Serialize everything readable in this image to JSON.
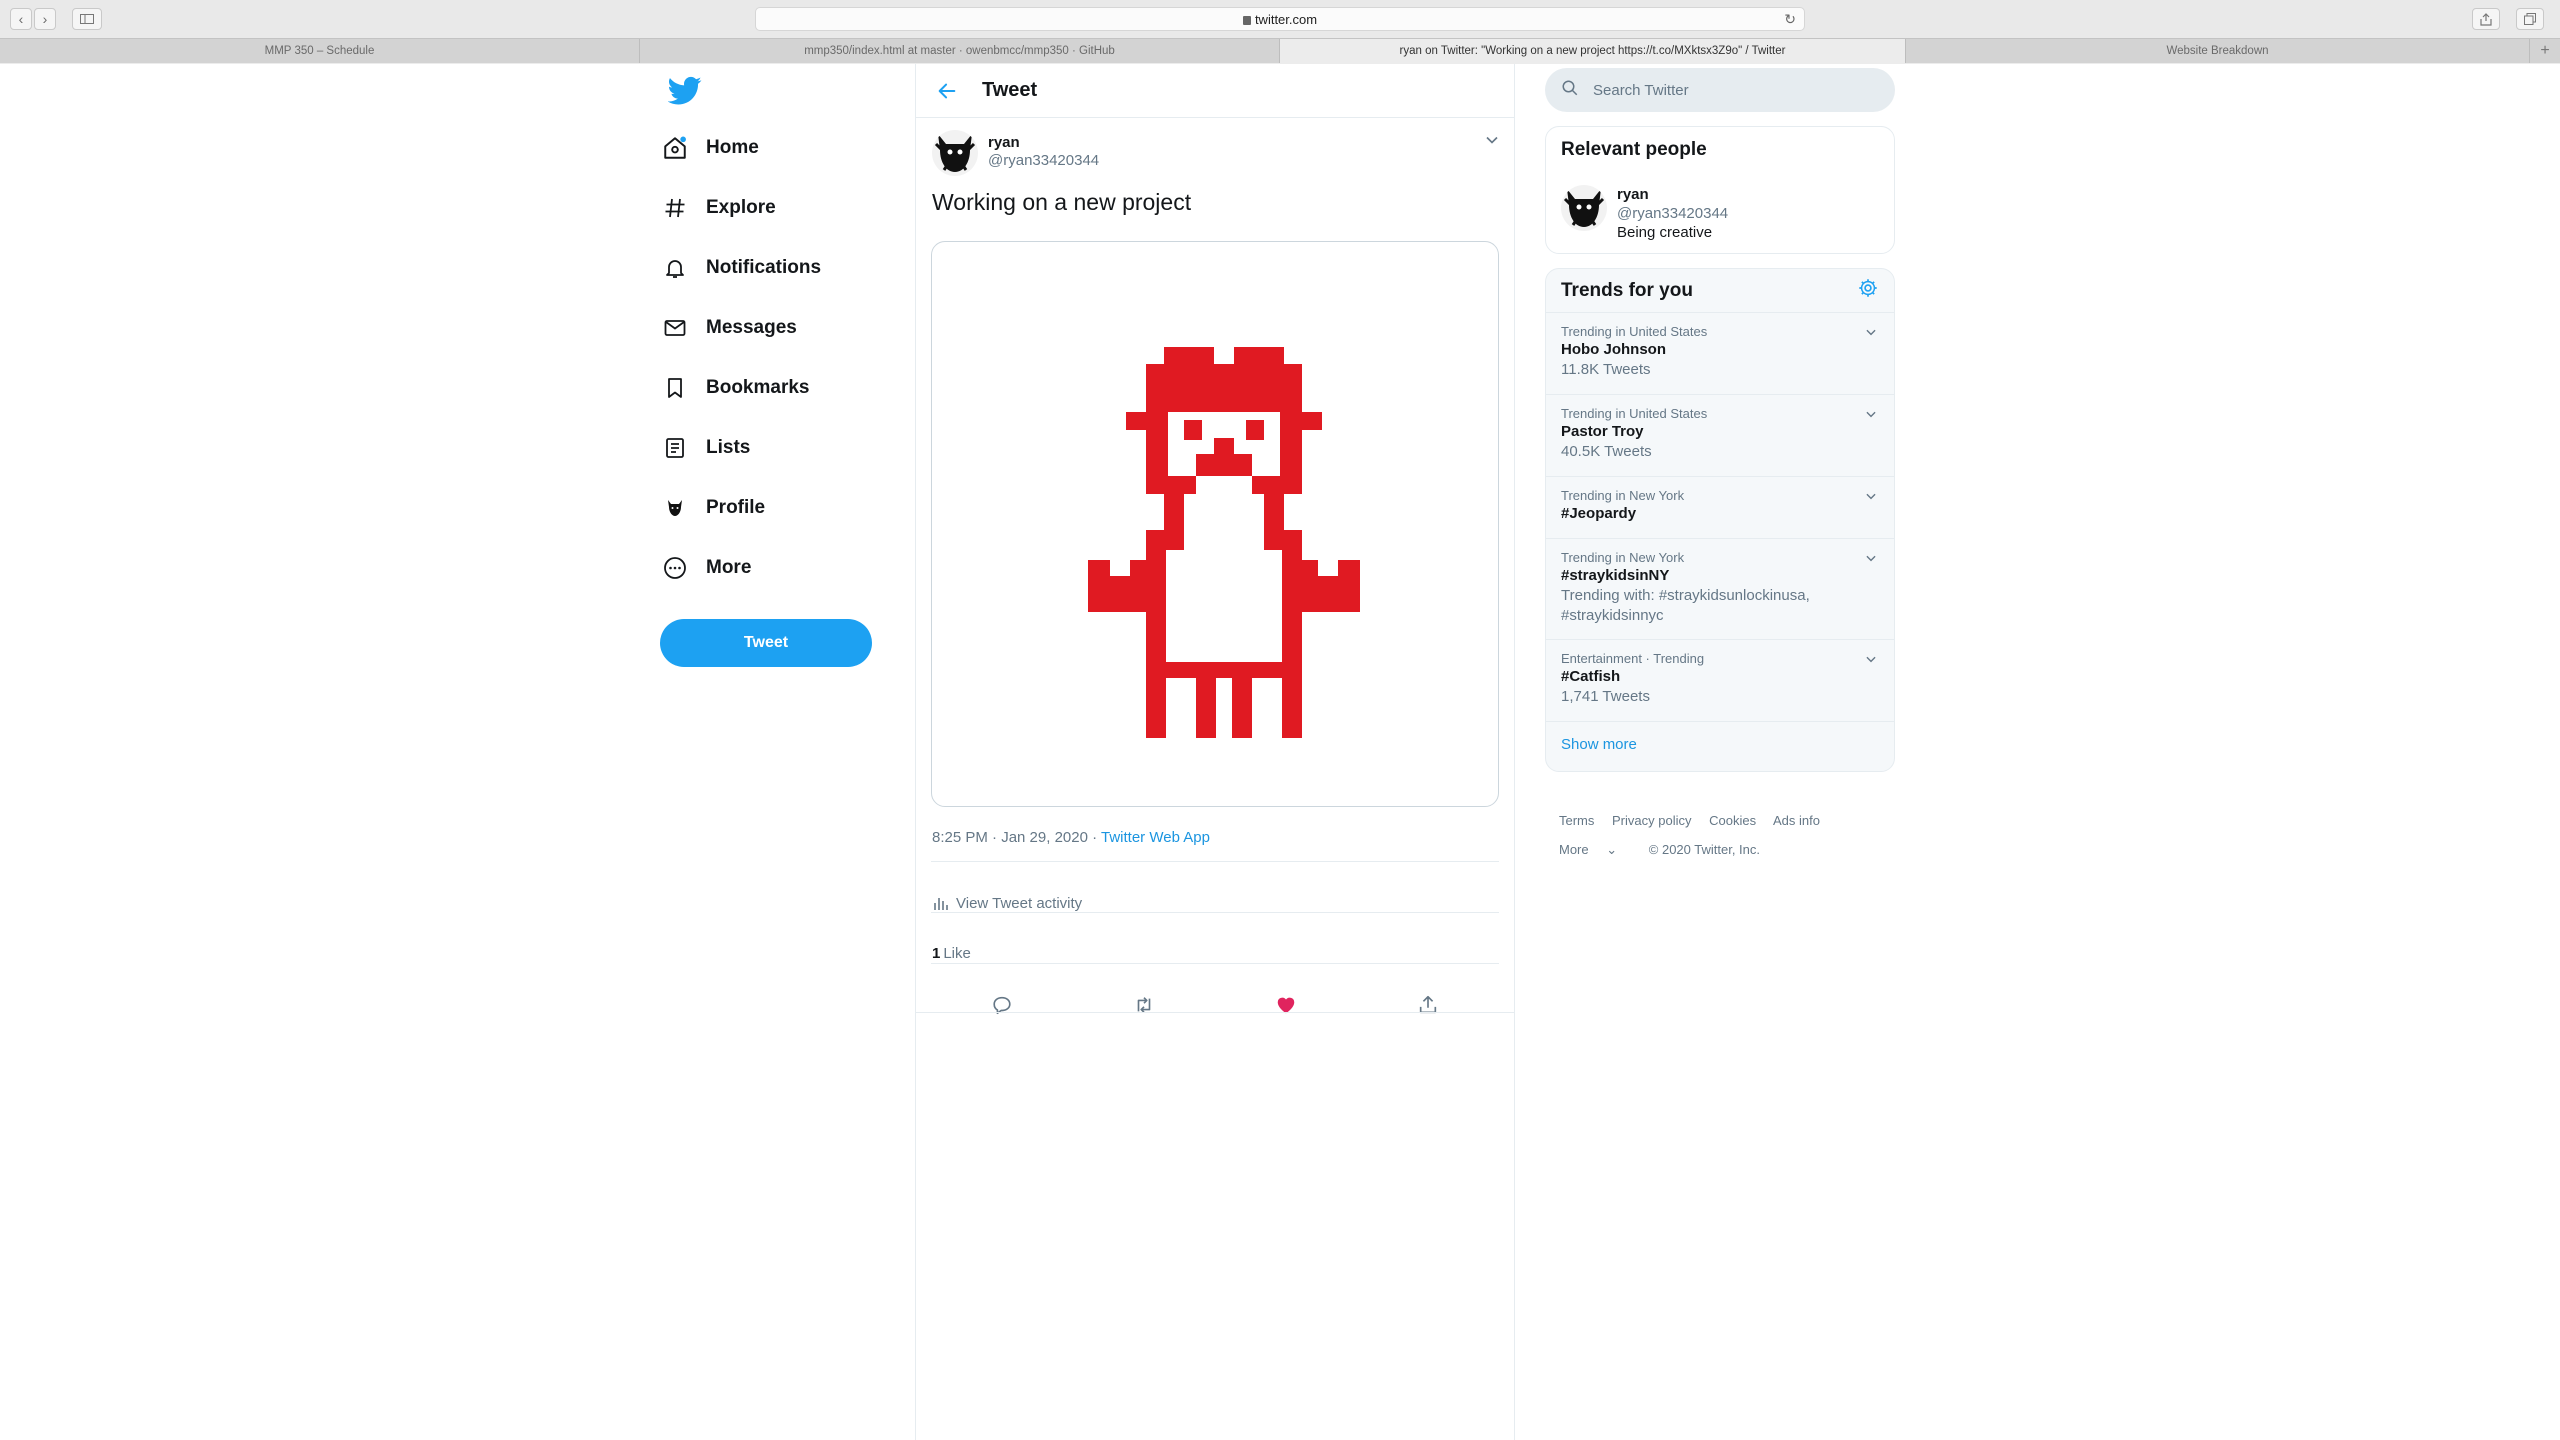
{
  "browser": {
    "url": "twitter.com",
    "tabs": [
      {
        "title": "MMP 350 – Schedule",
        "active": false
      },
      {
        "title": "mmp350/index.html at master · owenbmcc/mmp350 · GitHub",
        "active": false
      },
      {
        "title": "ryan on Twitter: \"Working on a new project https://t.co/MXktsx3Z9o\" / Twitter",
        "active": true
      },
      {
        "title": "Website Breakdown",
        "active": false
      }
    ],
    "new_tab_label": "+"
  },
  "nav": {
    "items": [
      {
        "label": "Home",
        "icon": "home-icon"
      },
      {
        "label": "Explore",
        "icon": "hashtag-icon"
      },
      {
        "label": "Notifications",
        "icon": "bell-icon"
      },
      {
        "label": "Messages",
        "icon": "envelope-icon"
      },
      {
        "label": "Bookmarks",
        "icon": "bookmark-icon"
      },
      {
        "label": "Lists",
        "icon": "list-icon"
      },
      {
        "label": "Profile",
        "icon": "profile-avatar-icon"
      },
      {
        "label": "More",
        "icon": "more-circle-icon"
      }
    ],
    "tweet_button": "Tweet"
  },
  "main": {
    "title": "Tweet",
    "tweet": {
      "author_name": "ryan",
      "author_handle": "@ryan33420344",
      "text": "Working on a new project",
      "time": "8:25 PM · Jan 29, 2020 · ",
      "source": "Twitter Web App",
      "activity_label": "View Tweet activity",
      "likes_count": "1",
      "likes_label": "Like"
    },
    "colors": {
      "accent": "#1da1f2",
      "like": "#e0245e",
      "pixel_art": "#e01a22"
    }
  },
  "sidebar": {
    "search_placeholder": "Search Twitter",
    "relevant_title": "Relevant people",
    "person": {
      "name": "ryan",
      "handle": "@ryan33420344",
      "bio": "Being creative"
    },
    "trends_title": "Trends for you",
    "trends": [
      {
        "context": "Trending in United States",
        "name": "Hobo Johnson",
        "count": "11.8K Tweets"
      },
      {
        "context": "Trending in United States",
        "name": "Pastor Troy",
        "count": "40.5K Tweets"
      },
      {
        "context": "Trending in New York",
        "name": "#Jeopardy",
        "count": ""
      },
      {
        "context": "Trending in New York",
        "name": "#straykidsinNY",
        "count": "Trending with: #straykidsunlockinusa, #straykidsinnyc"
      },
      {
        "context": "Entertainment · Trending",
        "name": "#Catfish",
        "count": "1,741 Tweets"
      }
    ],
    "show_more": "Show more",
    "footer": {
      "links": [
        "Terms",
        "Privacy policy",
        "Cookies",
        "Ads info"
      ],
      "more": "More",
      "copyright": "© 2020 Twitter, Inc."
    }
  }
}
